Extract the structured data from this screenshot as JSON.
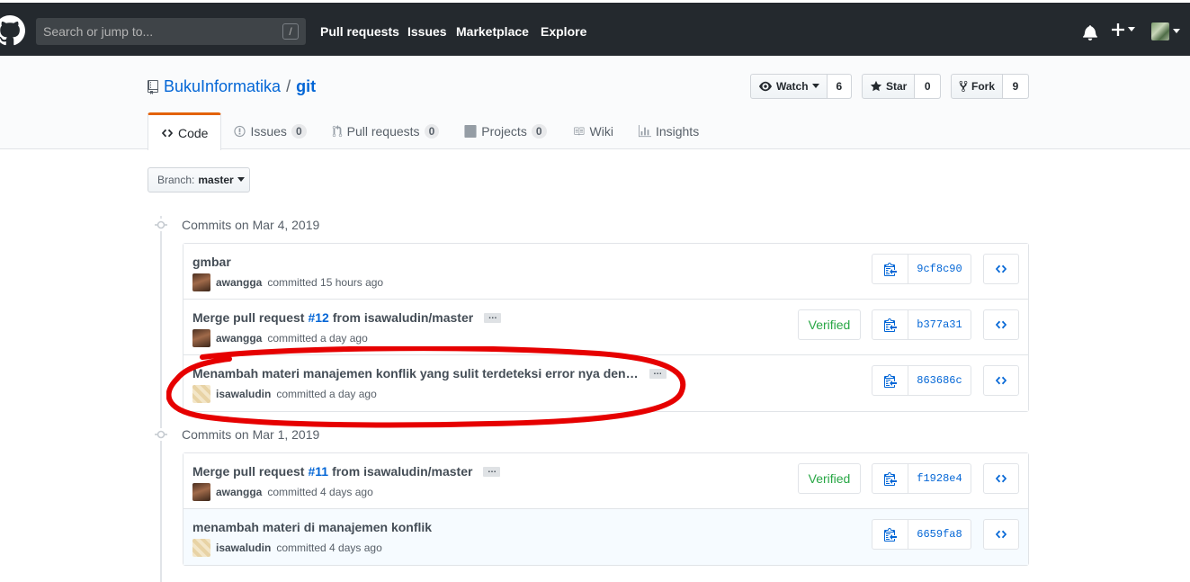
{
  "header": {
    "search_placeholder": "Search or jump to...",
    "slash_hint": "/",
    "nav": [
      "Pull requests",
      "Issues",
      "Marketplace",
      "Explore"
    ]
  },
  "repo": {
    "owner": "BukuInformatika",
    "separator": "/",
    "name": "git",
    "watch": {
      "label": "Watch",
      "count": "6"
    },
    "star": {
      "label": "Star",
      "count": "0"
    },
    "fork": {
      "label": "Fork",
      "count": "9"
    }
  },
  "tabs": [
    {
      "label": "Code",
      "selected": true
    },
    {
      "label": "Issues",
      "count": "0"
    },
    {
      "label": "Pull requests",
      "count": "0"
    },
    {
      "label": "Projects",
      "count": "0"
    },
    {
      "label": "Wiki"
    },
    {
      "label": "Insights"
    }
  ],
  "branch": {
    "label": "Branch:",
    "value": "master"
  },
  "commit_groups": [
    {
      "title": "Commits on Mar 4, 2019",
      "commits": [
        {
          "message": "gmbar",
          "author": "awangga",
          "time": "committed 15 hours ago",
          "sha": "9cf8c90",
          "verified": false
        },
        {
          "message_pre": "Merge pull request",
          "issue": "#12",
          "message_post": "from isawaludin/master",
          "ellipsis": "…",
          "author": "awangga",
          "time": "committed a day ago",
          "sha": "b377a31",
          "verified": true,
          "verified_label": "Verified"
        },
        {
          "message": "Menambah materi manajemen konflik yang sulit terdeteksi error nya den…",
          "ellipsis": "…",
          "author": "isawaludin",
          "time": "committed a day ago",
          "sha": "863686c",
          "verified": false
        }
      ]
    },
    {
      "title": "Commits on Mar 1, 2019",
      "commits": [
        {
          "message_pre": "Merge pull request",
          "issue": "#11",
          "message_post": "from isawaludin/master",
          "ellipsis": "…",
          "author": "awangga",
          "time": "committed 4 days ago",
          "sha": "f1928e4",
          "verified": true,
          "verified_label": "Verified"
        },
        {
          "message": "menambah materi di manajemen konflik",
          "author": "isawaludin",
          "time": "committed 4 days ago",
          "sha": "6659fa8",
          "verified": false
        }
      ]
    }
  ],
  "colors": {
    "header_bg": "#24292e",
    "link": "#0366d6",
    "verified": "#28a745",
    "annotation": "#e60000",
    "tab_accent": "#e36209"
  },
  "icons": [
    "github-logo-icon",
    "bell-icon",
    "plus-icon",
    "eye-icon",
    "star-icon",
    "fork-icon",
    "code-icon",
    "issue-icon",
    "pull-request-icon",
    "project-icon",
    "wiki-icon",
    "graph-icon",
    "clippy-icon"
  ]
}
